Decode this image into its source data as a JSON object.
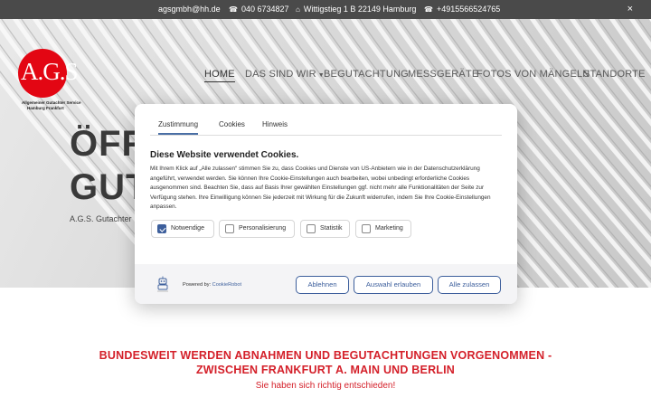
{
  "topbar": {
    "email": "agsgmbh@hh.de",
    "phone1": "040 6734827",
    "address": "Wittigstieg 1 B 22149 Hamburg",
    "phone2": "+4915566524765",
    "close": "×"
  },
  "logo": {
    "letters": "A.G.S",
    "line1": "Allgemeiner Gutachter Service",
    "line2": "Hamburg Frankfurt"
  },
  "nav": {
    "items": [
      "HOME",
      "DAS SIND WIR",
      "BEGUTACHTUNG",
      "MESSGERÄTE",
      "FOTOS VON MÄNGELN",
      "STANDORTE"
    ],
    "active": "HOME"
  },
  "hero": {
    "line1": "ÖFF",
    "line2": "GUT",
    "sub": "A.G.S. Gutachter"
  },
  "cookie": {
    "tabs": [
      "Zustimmung",
      "Cookies",
      "Hinweis"
    ],
    "title": "Diese Website verwendet Cookies.",
    "text": "Mit Ihrem Klick auf „Alle zulassen“ stimmen Sie zu, dass Cookies und Dienste von US-Anbietern wie in der Datenschutzerklärung angeführt, verwendet werden. Sie können Ihre Cookie-Einstellungen auch bearbeiten, wobei unbedingt erforderliche Cookies ausgenommen sind. Beachten Sie, dass auf Basis Ihrer gewählten Einstellungen ggf. nicht mehr alle Funktionalitäten der Seite zur Verfügung stehen. Ihre Einwilligung können Sie jederzeit mit Wirkung für die Zukunft widerrufen, indem Sie Ihre Cookie-Einstellungen anpassen.",
    "options": [
      {
        "label": "Notwendige",
        "checked": true
      },
      {
        "label": "Personalisierung",
        "checked": false
      },
      {
        "label": "Statistik",
        "checked": false
      },
      {
        "label": "Marketing",
        "checked": false
      }
    ],
    "powered_prefix": "Powered by:",
    "powered_brand": "CookieRobot",
    "buttons": {
      "decline": "Ablehnen",
      "selection": "Auswahl erlauben",
      "accept_all": "Alle zulassen"
    }
  },
  "content": {
    "headline_line1": "BUNDESWEIT WERDEN ABNAHMEN UND BEGUTACHTUNGEN VORGENOMMEN -",
    "headline_line2": "ZWISCHEN FRANKFURT A. MAIN UND BERLIN",
    "tagline": "Sie haben sich richtig entschieden!"
  },
  "colors": {
    "topbar_bg": "#4a4a4a",
    "brand_red": "#e30613",
    "headline_red": "#d4202a",
    "button_blue": "#3d5f9c"
  }
}
